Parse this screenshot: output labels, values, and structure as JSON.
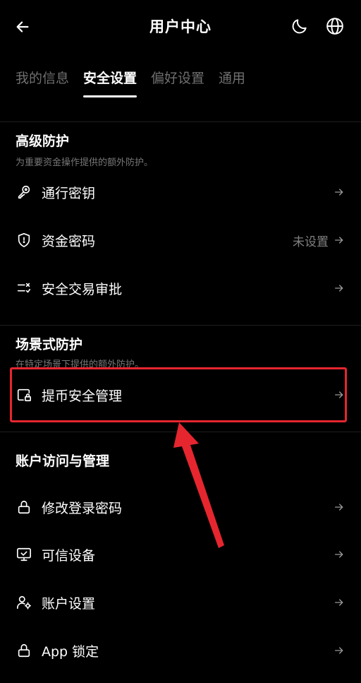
{
  "header": {
    "title": "用户中心",
    "back_icon": "arrow-left-icon",
    "theme_icon": "moon-icon",
    "language_icon": "globe-icon"
  },
  "tabs": [
    {
      "label": "我的信息",
      "active": false
    },
    {
      "label": "安全设置",
      "active": true
    },
    {
      "label": "偏好设置",
      "active": false
    },
    {
      "label": "通用",
      "active": false
    }
  ],
  "sections": [
    {
      "title": "高级防护",
      "subtitle": "为重要资金操作提供的额外防护。",
      "items": [
        {
          "icon": "key-icon",
          "label": "通行密钥",
          "status": ""
        },
        {
          "icon": "shield-icon",
          "label": "资金密码",
          "status": "未设置"
        },
        {
          "icon": "checklist-icon",
          "label": "安全交易审批",
          "status": ""
        }
      ]
    },
    {
      "title": "场景式防护",
      "subtitle": "在特定场景下提供的额外防护。",
      "items": [
        {
          "icon": "wallet-lock-icon",
          "label": "提币安全管理",
          "status": ""
        }
      ]
    },
    {
      "title": "账户访问与管理",
      "subtitle": "",
      "items": [
        {
          "icon": "lock-icon",
          "label": "修改登录密码",
          "status": ""
        },
        {
          "icon": "monitor-check-icon",
          "label": "可信设备",
          "status": ""
        },
        {
          "icon": "user-settings-icon",
          "label": "账户设置",
          "status": ""
        },
        {
          "icon": "lock-icon",
          "label": "App 锁定",
          "status": ""
        }
      ]
    }
  ],
  "colors": {
    "background": "#000000",
    "text": "#ffffff",
    "muted": "#777777",
    "highlight": "#e5262f"
  }
}
